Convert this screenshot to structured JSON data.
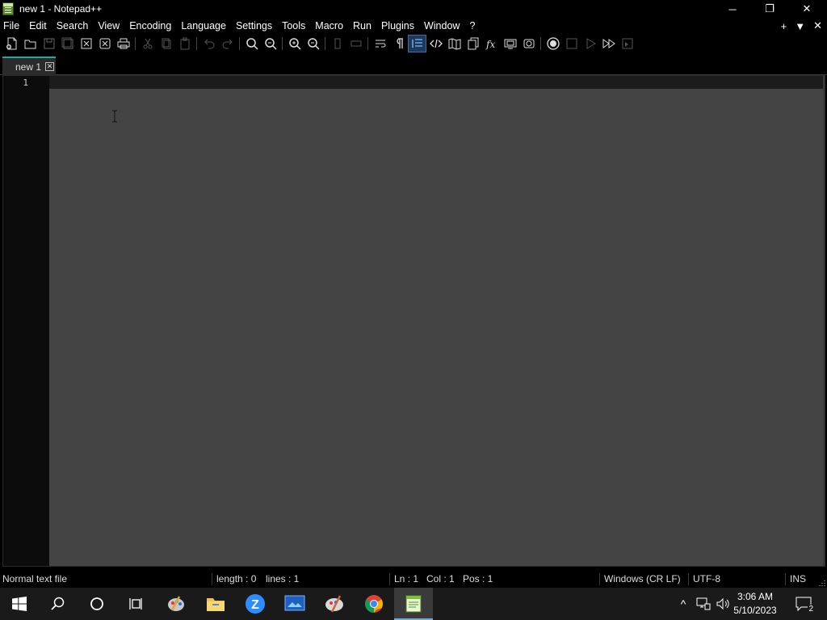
{
  "window": {
    "title": "new 1 - Notepad++",
    "minimize_glyph": "─",
    "restore_glyph": "❐",
    "close_glyph": "✕"
  },
  "menu": {
    "items": [
      "File",
      "Edit",
      "Search",
      "View",
      "Encoding",
      "Language",
      "Settings",
      "Tools",
      "Macro",
      "Run",
      "Plugins",
      "Window",
      "?"
    ],
    "right": {
      "add": "+",
      "dropdown": "▼",
      "close": "✕"
    }
  },
  "toolbar": {
    "buttons": [
      "new-file-icon",
      "open-file-icon",
      "save-icon",
      "save-all-icon",
      "close-icon",
      "close-all-icon",
      "print-icon",
      "cut-icon",
      "copy-icon",
      "paste-icon",
      "undo-icon",
      "redo-icon",
      "find-icon",
      "replace-icon",
      "zoom-in-icon",
      "zoom-out-icon",
      "sync-vertical-icon",
      "sync-horizontal-icon",
      "word-wrap-icon",
      "show-all-characters-icon",
      "indent-guide-icon",
      "xml-tag-icon",
      "document-map-icon",
      "document-list-icon",
      "function-list-icon",
      "folder-as-workspace-icon",
      "monitoring-icon",
      "record-macro-icon",
      "stop-recording-icon",
      "playback-macro-icon",
      "run-macro-multiple-icon",
      "save-macro-icon"
    ]
  },
  "tabs": [
    {
      "label": "new 1",
      "close": "✕",
      "active": true
    }
  ],
  "editor": {
    "line_numbers": [
      "1"
    ],
    "content": ""
  },
  "status": {
    "file_type": "Normal text file",
    "length": "length : 0",
    "lines": "lines : 1",
    "ln": "Ln : 1",
    "col": "Col : 1",
    "pos": "Pos : 1",
    "eol": "Windows (CR LF)",
    "encoding": "UTF-8",
    "mode": "INS"
  },
  "taskbar": {
    "apps": [
      "windows-start-icon",
      "search-icon",
      "cortana-icon",
      "task-view-icon",
      "paint-app-icon",
      "file-explorer-icon",
      "zoom-app-icon",
      "screen-app-icon",
      "tool-app-icon",
      "chrome-icon",
      "notepad-plus-plus-icon"
    ],
    "zoom_letter": "Z",
    "tray": {
      "chevron": "^",
      "time": "3:06 AM",
      "date": "5/10/2023",
      "notification_count": "2"
    }
  },
  "colors": {
    "accent_tab": "#36a09a",
    "editor_bg": "#444444",
    "gutter_bg": "#0c0c0c"
  }
}
